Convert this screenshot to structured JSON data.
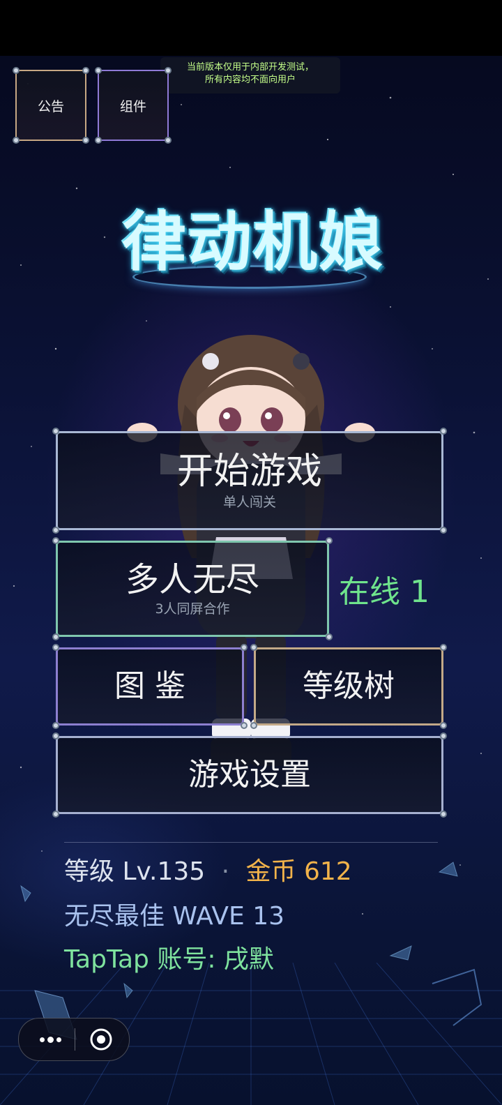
{
  "notice": {
    "line1": "当前版本仅用于内部开发测试，",
    "line2": "所有内容均不面向用户"
  },
  "top_buttons": {
    "announcement": "公告",
    "components": "组件"
  },
  "logo_text": "律动机娘",
  "menu": {
    "start": {
      "title": "开始游戏",
      "sub": "单人闯关"
    },
    "endless": {
      "title": "多人无尽",
      "sub": "3人同屏合作"
    },
    "online": "在线 1",
    "codex": "图 鉴",
    "level_tree": "等级树",
    "settings": "游戏设置"
  },
  "stats": {
    "level": "等级 Lv.135",
    "sep": "·",
    "coins": "金币 612",
    "best": "无尽最佳 WAVE 13",
    "account": "TapTap 账号: 戌默"
  },
  "colors": {
    "start_border": "#a9b8d4",
    "endless_border": "#7fc7ae",
    "codex_border": "#8d7fd0",
    "level_tree_border": "#c3a988",
    "settings_border": "#a6b0d0",
    "online_text": "#6fe38c",
    "coins_text": "#f2b34a",
    "best_text": "#a9c2ee",
    "account_text": "#7fe39e"
  },
  "icons": {
    "menu": "more-dots-icon",
    "close": "target-circle-icon"
  }
}
